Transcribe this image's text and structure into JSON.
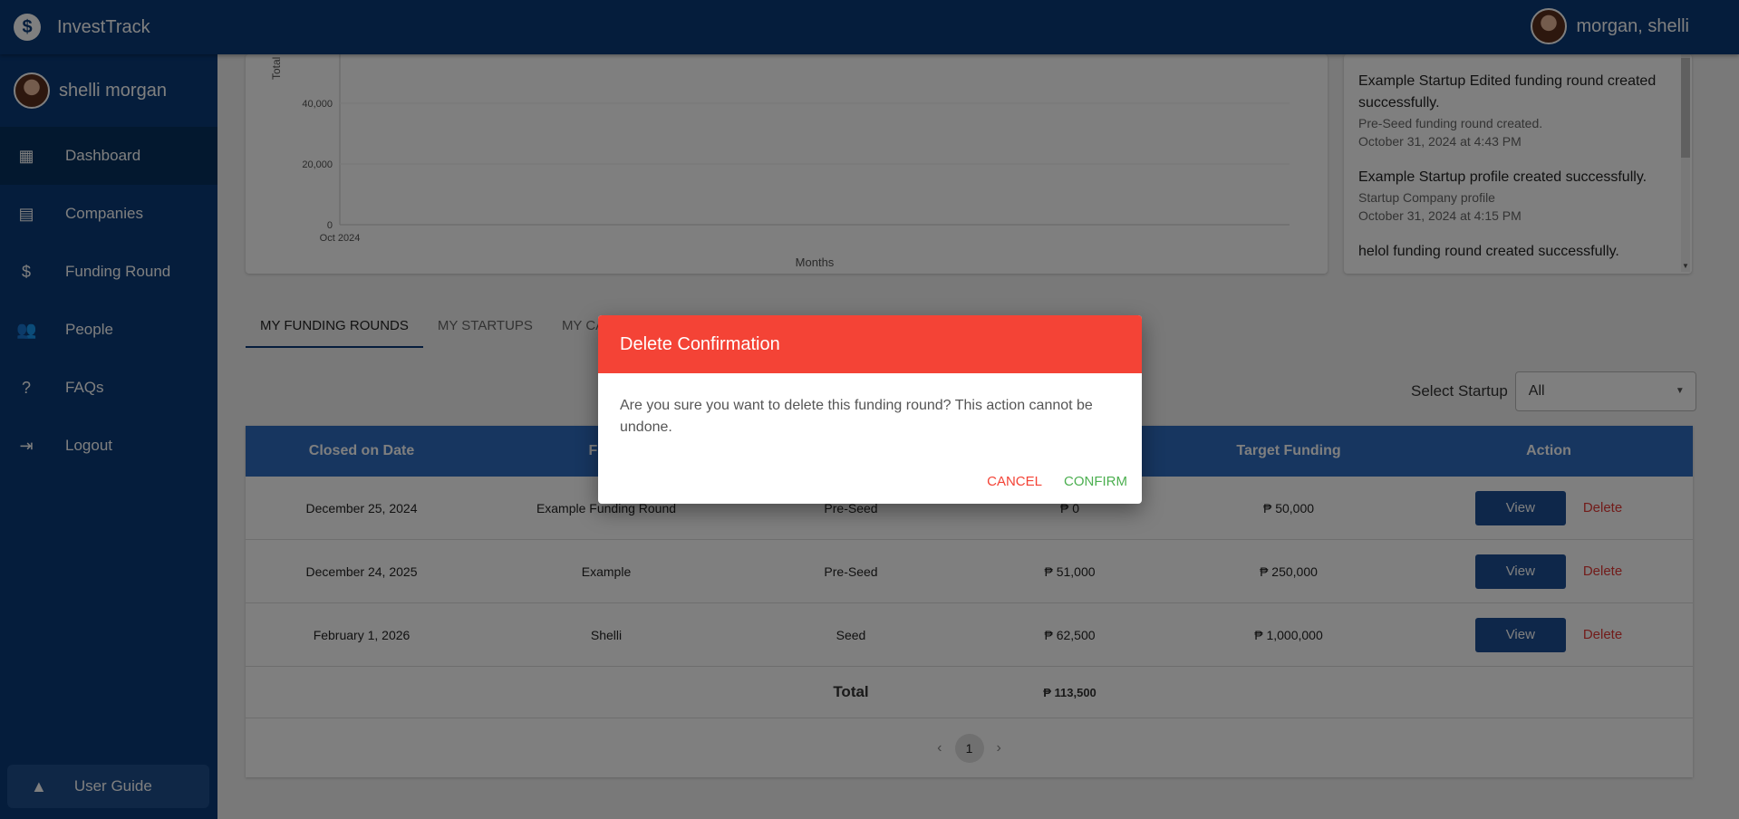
{
  "app": {
    "title": "InvestTrack",
    "logo_glyph": "$"
  },
  "topbar": {
    "user_name": "morgan, shelli"
  },
  "sidebar": {
    "user_name": "shelli morgan",
    "items": [
      {
        "label": "Dashboard",
        "icon": "dashboard-icon",
        "glyph": "▦"
      },
      {
        "label": "Companies",
        "icon": "store-icon",
        "glyph": "▤"
      },
      {
        "label": "Funding Round",
        "icon": "dollar-circle-icon",
        "glyph": "$"
      },
      {
        "label": "People",
        "icon": "people-icon",
        "glyph": "👥"
      },
      {
        "label": "FAQs",
        "icon": "help-circle-icon",
        "glyph": "?"
      },
      {
        "label": "Logout",
        "icon": "logout-icon",
        "glyph": "⇥"
      }
    ],
    "guide_label": "User Guide"
  },
  "chart_data": {
    "type": "line",
    "xlabel": "Months",
    "ylabel": "Total",
    "categories": [
      "Oct 2024"
    ],
    "y_ticks": [
      0,
      20000,
      40000
    ],
    "y_tick_labels": [
      "0",
      "20,000",
      "40,000"
    ],
    "series": [],
    "grid": true
  },
  "notifications": [
    {
      "title": "Example Startup Edited funding round created successfully.",
      "subtitle": "Pre-Seed funding round created.",
      "time": "October 31, 2024 at 4:43 PM"
    },
    {
      "title": "Example Startup profile created successfully.",
      "subtitle": "Startup Company profile",
      "time": "October 31, 2024 at 4:15 PM"
    },
    {
      "title": "helol funding round created successfully.",
      "subtitle": "",
      "time": ""
    }
  ],
  "tabs": [
    "MY FUNDING ROUNDS",
    "MY STARTUPS",
    "MY CA"
  ],
  "select": {
    "label": "Select Startup",
    "value": "All"
  },
  "table": {
    "headers": [
      "Closed on Date",
      "Fund",
      "",
      "",
      "Target Funding",
      "Action"
    ],
    "rows": [
      {
        "date": "December 25, 2024",
        "name": "Example Funding Round",
        "stage": "Pre-Seed",
        "raised": "₱ 0",
        "target": "₱ 50,000"
      },
      {
        "date": "December 24, 2025",
        "name": "Example",
        "stage": "Pre-Seed",
        "raised": "₱ 51,000",
        "target": "₱ 250,000"
      },
      {
        "date": "February 1, 2026",
        "name": "Shelli",
        "stage": "Seed",
        "raised": "₱ 62,500",
        "target": "₱ 1,000,000"
      }
    ],
    "view_label": "View",
    "delete_label": "Delete",
    "total_label": "Total",
    "total_value": "₱ 113,500",
    "current_page": "1"
  },
  "dialog": {
    "title": "Delete Confirmation",
    "message": "Are you sure you want to delete this funding round? This action cannot be undone.",
    "cancel_label": "CANCEL",
    "confirm_label": "CONFIRM"
  },
  "colors": {
    "primary": "#0a3a78",
    "table_header": "#2e6dc0",
    "danger": "#f44336",
    "confirm": "#4caf50"
  }
}
